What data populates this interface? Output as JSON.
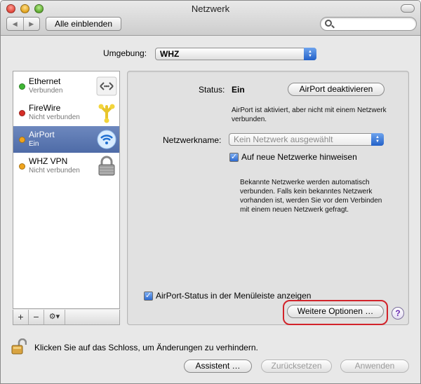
{
  "window": {
    "title": "Netzwerk"
  },
  "toolbar": {
    "back_glyph": "◀",
    "forward_glyph": "▶",
    "show_all_label": "Alle einblenden",
    "search_placeholder": "",
    "search_icon": "magnifier-icon"
  },
  "location": {
    "label": "Umgebung:",
    "value": "WHZ"
  },
  "services": [
    {
      "name": "Ethernet",
      "status": "Verbunden",
      "dot_color": "#3fb635",
      "icon": "ethernet-icon"
    },
    {
      "name": "FireWire",
      "status": "Nicht verbunden",
      "dot_color": "#d62e27",
      "icon": "firewire-icon"
    },
    {
      "name": "AirPort",
      "status": "Ein",
      "dot_color": "#f0a41d",
      "icon": "wifi-icon",
      "selected": true
    },
    {
      "name": "WHZ VPN",
      "status": "Nicht verbunden",
      "dot_color": "#f0a41d",
      "icon": "vpn-lock-icon"
    }
  ],
  "sidebar_buttons": {
    "add": "+",
    "remove": "−",
    "action": "⚙▾"
  },
  "airport": {
    "status_label": "Status:",
    "status_value": "Ein",
    "toggle_button": "AirPort deaktivieren",
    "status_desc": "AirPort ist aktiviert, aber nicht mit einem Netzwerk verbunden.",
    "network_name_label": "Netzwerkname:",
    "network_name_value": "Kein Netzwerk ausgewählt",
    "ask_new_networks_label": "Auf neue Netzwerke hinweisen",
    "ask_new_networks_checked": true,
    "ask_desc": "Bekannte Netzwerke werden automatisch verbunden. Falls kein bekanntes Netzwerk vorhanden ist, werden Sie vor dem Verbinden mit einem neuen Netzwerk gefragt.",
    "menubar_label": "AirPort-Status in der Menüleiste anzeigen",
    "menubar_checked": true,
    "advanced_button": "Weitere Optionen …",
    "help_label": "?"
  },
  "footer": {
    "lock_text": "Klicken Sie auf das Schloss, um Änderungen zu verhindern.",
    "assistant_button": "Assistent …",
    "revert_button": "Zurücksetzen",
    "apply_button": "Anwenden"
  },
  "colors": {
    "selection": "#5a76b0",
    "highlight_ring": "#d2232a",
    "popup_arrow": "#2f6fd5"
  }
}
